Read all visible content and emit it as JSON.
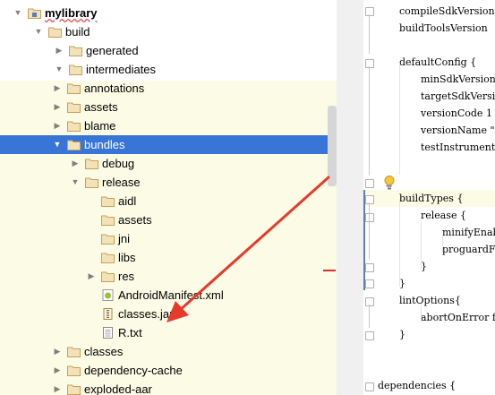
{
  "tree": {
    "items": [
      {
        "label": "mylibrary",
        "bold": true,
        "squiggle": true
      },
      {
        "label": "build"
      },
      {
        "label": "generated"
      },
      {
        "label": "intermediates"
      },
      {
        "label": "annotations"
      },
      {
        "label": "assets"
      },
      {
        "label": "blame"
      },
      {
        "label": "bundles",
        "selected": true
      },
      {
        "label": "debug"
      },
      {
        "label": "release"
      },
      {
        "label": "aidl"
      },
      {
        "label": "assets"
      },
      {
        "label": "jni"
      },
      {
        "label": "libs"
      },
      {
        "label": "res"
      },
      {
        "label": "AndroidManifest.xml"
      },
      {
        "label": "classes.jar"
      },
      {
        "label": "R.txt"
      },
      {
        "label": "classes"
      },
      {
        "label": "dependency-cache"
      },
      {
        "label": "exploded-aar"
      }
    ]
  },
  "editor": {
    "lines": [
      "compileSdkVersion",
      "buildToolsVersion",
      "",
      "defaultConfig {",
      "minSdkVersion",
      "targetSdkVersi",
      "versionCode 1",
      "versionName \"1",
      "testInstrument",
      "",
      "}",
      "buildTypes {",
      "release {",
      "minifyEnab",
      "proguardFi",
      "}",
      "}",
      "lintOptions{",
      "abortOnError f",
      "}",
      "",
      "",
      "dependencies {"
    ]
  },
  "colors": {
    "selection": "#3875d7",
    "folder": "#c8a058",
    "highlight": "#fcfbe6",
    "arrow": "#e53b2c"
  },
  "icons": {
    "folder": "folder-icon",
    "module": "module-folder-icon",
    "xml": "android-manifest-icon",
    "jar": "jar-file-icon",
    "text": "text-file-icon",
    "bulb": "lightbulb-icon"
  }
}
